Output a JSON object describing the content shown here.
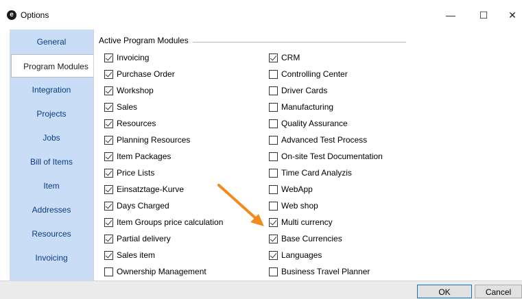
{
  "window": {
    "icon_letter": "e",
    "title": "Options",
    "minimize": "—",
    "maximize": "☐",
    "close": "✕"
  },
  "tabs": [
    {
      "label": "General",
      "active": false
    },
    {
      "label": "Program Modules",
      "active": true
    },
    {
      "label": "Integration",
      "active": false
    },
    {
      "label": "Projects",
      "active": false
    },
    {
      "label": "Jobs",
      "active": false
    },
    {
      "label": "Bill of Items",
      "active": false
    },
    {
      "label": "Item",
      "active": false
    },
    {
      "label": "Addresses",
      "active": false
    },
    {
      "label": "Resources",
      "active": false
    },
    {
      "label": "Invoicing",
      "active": false
    }
  ],
  "group": {
    "title": "Active Program Modules",
    "left_column": [
      {
        "label": "Invoicing",
        "checked": true
      },
      {
        "label": "Purchase Order",
        "checked": true
      },
      {
        "label": "Workshop",
        "checked": true
      },
      {
        "label": "Sales",
        "checked": true
      },
      {
        "label": "Resources",
        "checked": true
      },
      {
        "label": "Planning Resources",
        "checked": true
      },
      {
        "label": "Item Packages",
        "checked": true
      },
      {
        "label": "Price Lists",
        "checked": true
      },
      {
        "label": "Einsatztage-Kurve",
        "checked": true
      },
      {
        "label": "Days Charged",
        "checked": true
      },
      {
        "label": "Item Groups price calculation",
        "checked": true
      },
      {
        "label": "Partial delivery",
        "checked": true
      },
      {
        "label": "Sales item",
        "checked": true
      },
      {
        "label": "Ownership Management",
        "checked": false
      }
    ],
    "right_column": [
      {
        "label": "CRM",
        "checked": true
      },
      {
        "label": "Controlling Center",
        "checked": false
      },
      {
        "label": "Driver Cards",
        "checked": false
      },
      {
        "label": "Manufacturing",
        "checked": false
      },
      {
        "label": "Quality Assurance",
        "checked": false
      },
      {
        "label": "Advanced Test Process",
        "checked": false
      },
      {
        "label": "On-site Test Documentation",
        "checked": false
      },
      {
        "label": "Time Card Analyzis",
        "checked": false
      },
      {
        "label": "WebApp",
        "checked": false
      },
      {
        "label": "Web shop",
        "checked": false
      },
      {
        "label": "Multi currency",
        "checked": true
      },
      {
        "label": "Base Currencies",
        "checked": true
      },
      {
        "label": "Languages",
        "checked": true
      },
      {
        "label": "Business Travel Planner",
        "checked": false
      }
    ]
  },
  "buttons": {
    "ok": "OK",
    "cancel": "Cancel"
  },
  "colors": {
    "tab_strip": "#c9ddf7",
    "tab_text": "#0a3b82",
    "arrow": "#f28a1e"
  }
}
